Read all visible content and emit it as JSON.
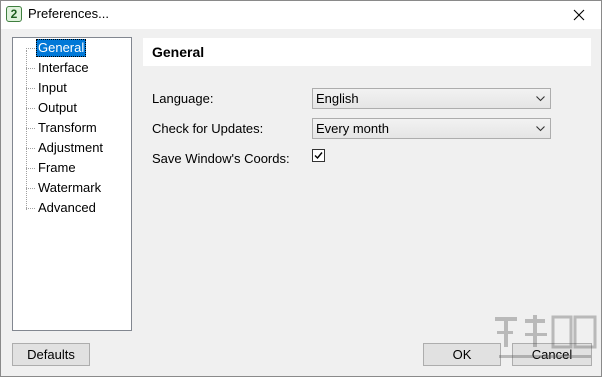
{
  "window": {
    "title": "Preferences...",
    "app_icon_glyph": "2"
  },
  "tree": {
    "items": [
      {
        "label": "General",
        "selected": true
      },
      {
        "label": "Interface"
      },
      {
        "label": "Input"
      },
      {
        "label": "Output"
      },
      {
        "label": "Transform"
      },
      {
        "label": "Adjustment"
      },
      {
        "label": "Frame"
      },
      {
        "label": "Watermark"
      },
      {
        "label": "Advanced"
      }
    ]
  },
  "general": {
    "header": "General",
    "language": {
      "label": "Language:",
      "value": "English"
    },
    "updates": {
      "label": "Check for Updates:",
      "value": "Every month"
    },
    "save_coords": {
      "label": "Save Window's Coords:",
      "checked": true
    }
  },
  "buttons": {
    "defaults": "Defaults",
    "ok": "OK",
    "cancel": "Cancel"
  },
  "icons": {
    "close": "close-icon",
    "dropdown": "chevron-down-icon",
    "check": "checkmark-icon"
  },
  "colors": {
    "selection": "#0078d7"
  }
}
